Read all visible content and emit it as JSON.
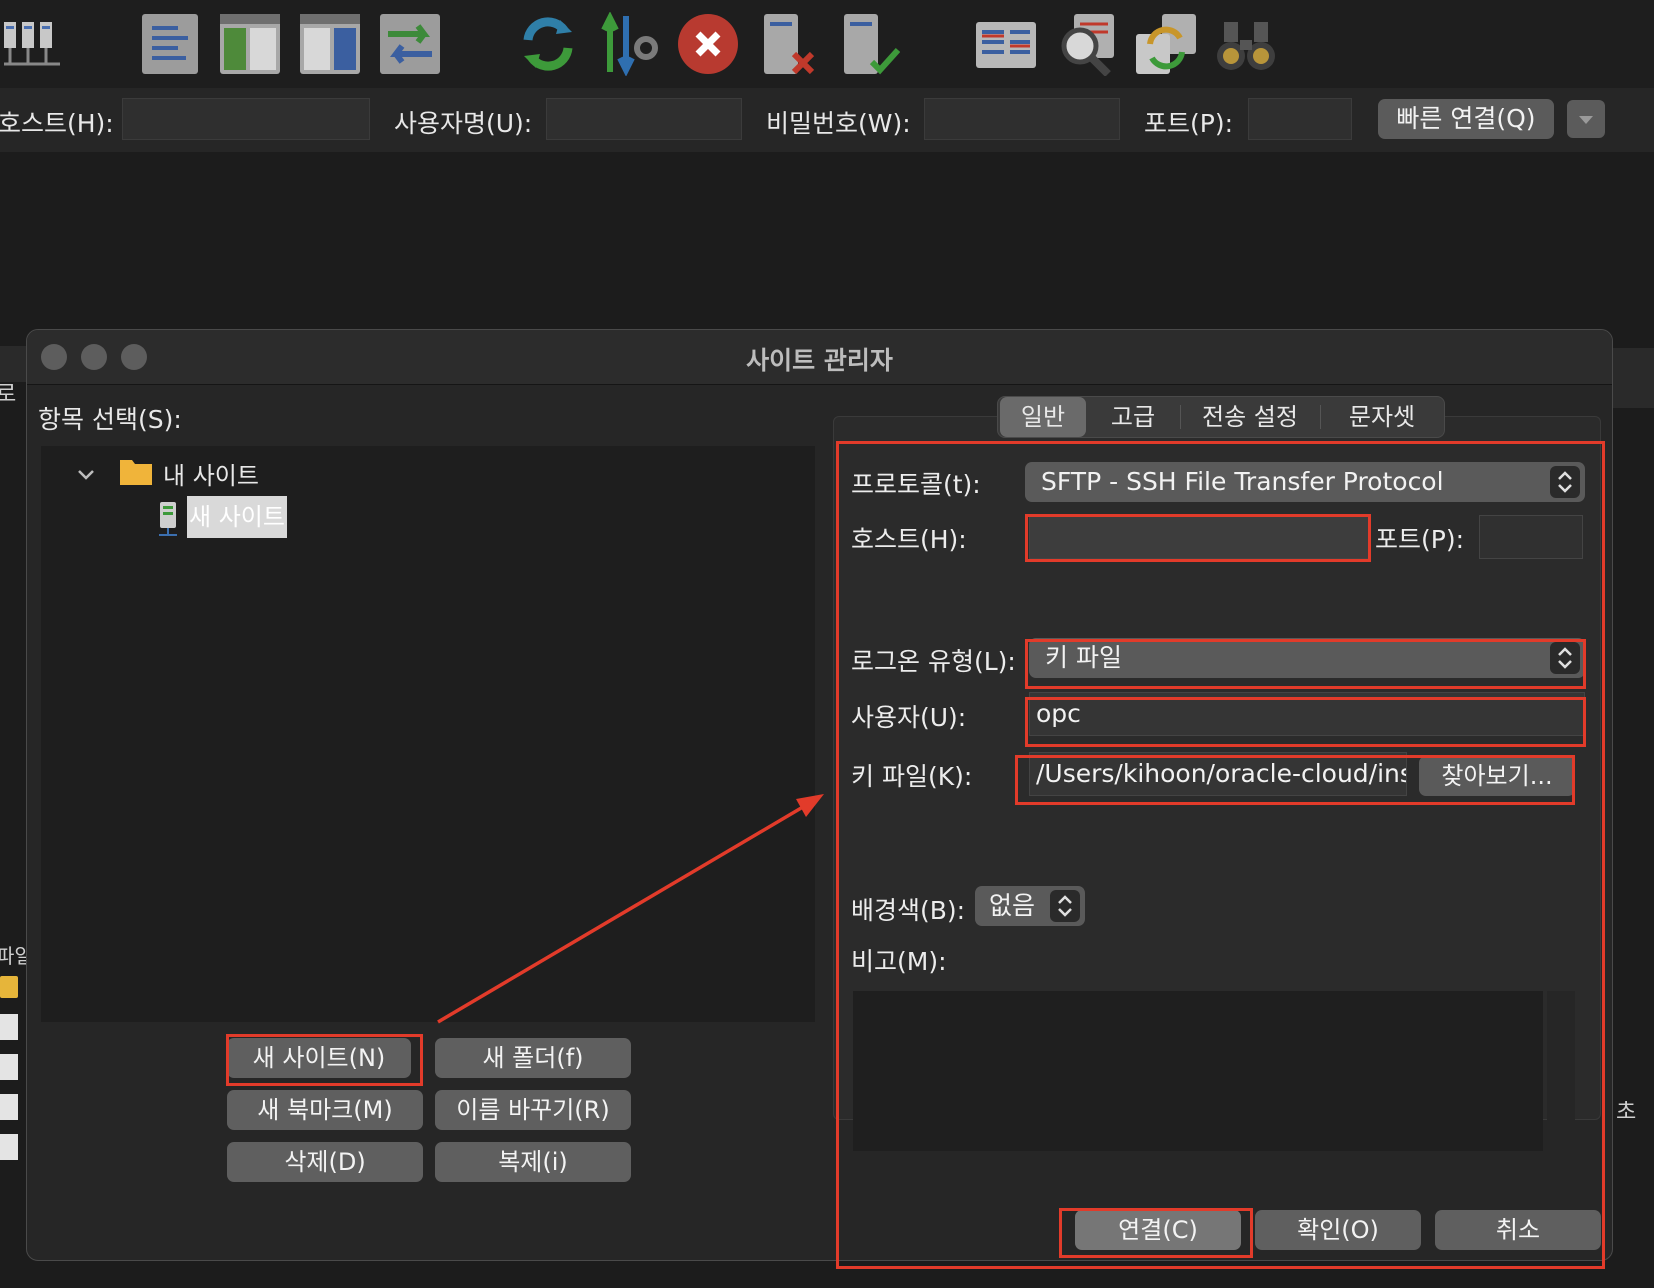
{
  "quickconnect": {
    "host_label": "호스트(H):",
    "user_label": "사용자명(U):",
    "password_label": "비밀번호(W):",
    "port_label": "포트(P):",
    "connect_button": "빠른 연결(Q)"
  },
  "background": {
    "left_fragment_1": "로",
    "left_fragment_2": "파일",
    "right_fragment": "초"
  },
  "dialog": {
    "title": "사이트 관리자",
    "select_label": "항목 선택(S):",
    "tree": {
      "folder": "내 사이트",
      "site": "새 사이트"
    },
    "buttons": {
      "new_site": "새 사이트(N)",
      "new_folder": "새 폴더(f)",
      "new_bookmark": "새 북마크(M)",
      "rename": "이름 바꾸기(R)",
      "delete": "삭제(D)",
      "duplicate": "복제(i)",
      "connect": "연결(C)",
      "ok": "확인(O)",
      "cancel": "취소"
    },
    "tabs": [
      "일반",
      "고급",
      "전송 설정",
      "문자셋"
    ],
    "general": {
      "protocol_label": "프로토콜(t):",
      "protocol_value": "SFTP - SSH File Transfer Protocol",
      "host_label": "호스트(H):",
      "host_value": "",
      "port_label": "포트(P):",
      "port_value": "",
      "logon_type_label": "로그온 유형(L):",
      "logon_type_value": "키 파일",
      "user_label": "사용자(U):",
      "user_value": "opc",
      "keyfile_label": "키 파일(K):",
      "keyfile_value": "/Users/kihoon/oracle-cloud/ins",
      "browse_button": "찾아보기...",
      "background_label": "배경색(B):",
      "background_value": "없음",
      "comments_label": "비고(M):"
    }
  },
  "colors": {
    "annotation_red": "#e23b2a",
    "dialog_bg": "#262626",
    "button_gray": "#5f5f5f"
  }
}
